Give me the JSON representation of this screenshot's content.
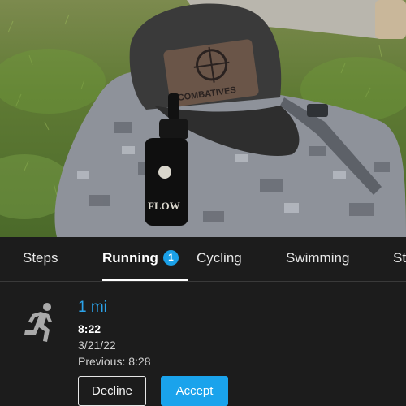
{
  "photo": {
    "patch_text": "COMBATIVES",
    "bottle_text": "FLOW"
  },
  "tabs": [
    {
      "label": "Steps",
      "active": false
    },
    {
      "label": "Running",
      "active": true,
      "badge": "1"
    },
    {
      "label": "Cycling",
      "active": false
    },
    {
      "label": "Swimming",
      "active": false
    },
    {
      "label": "St",
      "active": false
    }
  ],
  "activity": {
    "icon": "running-person-icon",
    "distance": "1 mi",
    "pace": "8:22",
    "date": "3/21/22",
    "previous": "Previous: 8:28"
  },
  "buttons": {
    "decline": "Decline",
    "accept": "Accept"
  },
  "colors": {
    "accent": "#1aa3ec",
    "background": "#1c1c1c",
    "text": "#ffffff"
  }
}
